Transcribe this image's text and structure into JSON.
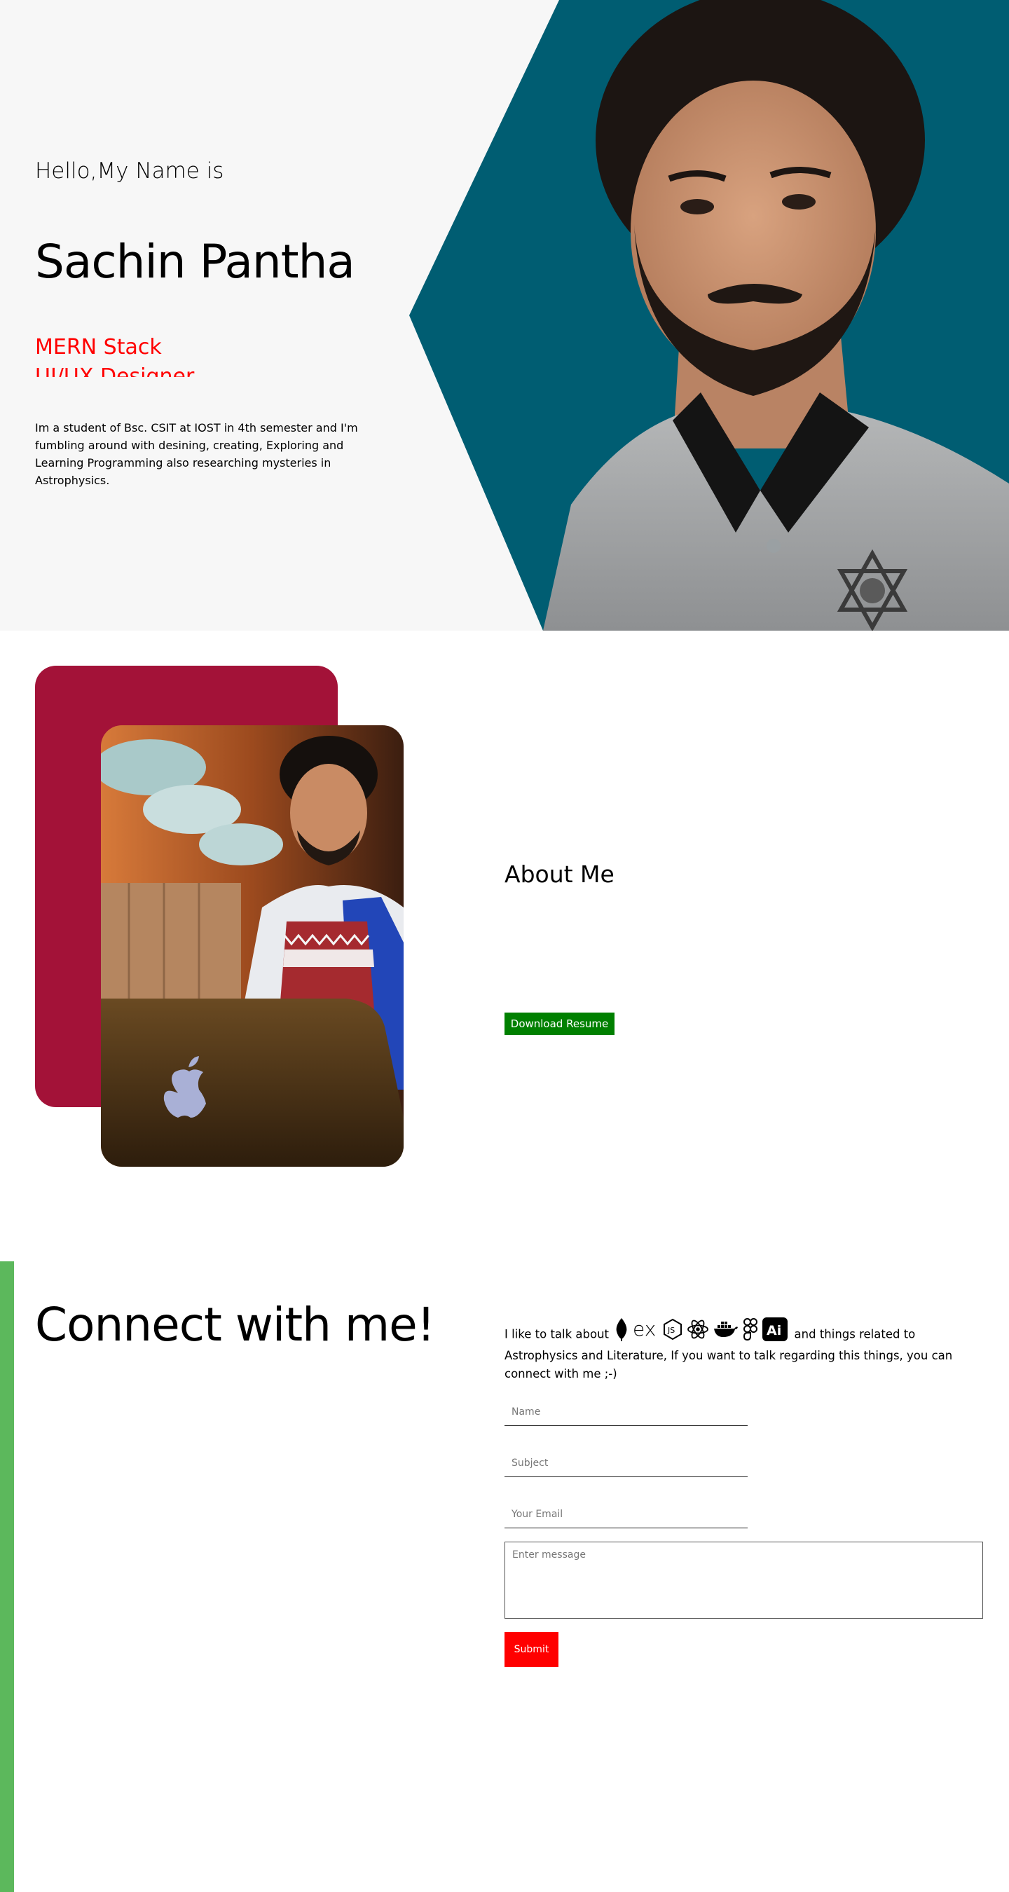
{
  "hero": {
    "greeting": "Hello,My Name is",
    "name": "Sachin Pantha",
    "roles": [
      "MERN Stack",
      "UI/UX Designer"
    ],
    "bio": "Im a student of Bsc. CSIT at IOST in 4th semester and I'm fumbling around with desining, creating, Exploring and Learning Programming also researching mysteries in Astrophysics.",
    "accent_color": "#005d72",
    "role_color": "#ff0000"
  },
  "about": {
    "title": "About Me",
    "download_label": "Download Resume",
    "card_color": "#a31238",
    "button_color": "#008000"
  },
  "connect": {
    "title": "Connect with me!",
    "talk_prefix": "I like to talk about",
    "talk_suffix": "and things related to Astrophysics and Literature, If you want to talk regarding this things, you can connect with me ;-)",
    "icons": [
      "mongodb-icon",
      "express-icon",
      "nodejs-icon",
      "react-icon",
      "docker-icon",
      "figma-icon",
      "illustrator-icon"
    ],
    "name_placeholder": "Name",
    "subject_placeholder": "Subject",
    "email_placeholder": "Your Email",
    "message_placeholder": "Enter message",
    "submit_label": "Submit",
    "bar_color": "#5cb85c",
    "submit_color": "#ff0000"
  }
}
